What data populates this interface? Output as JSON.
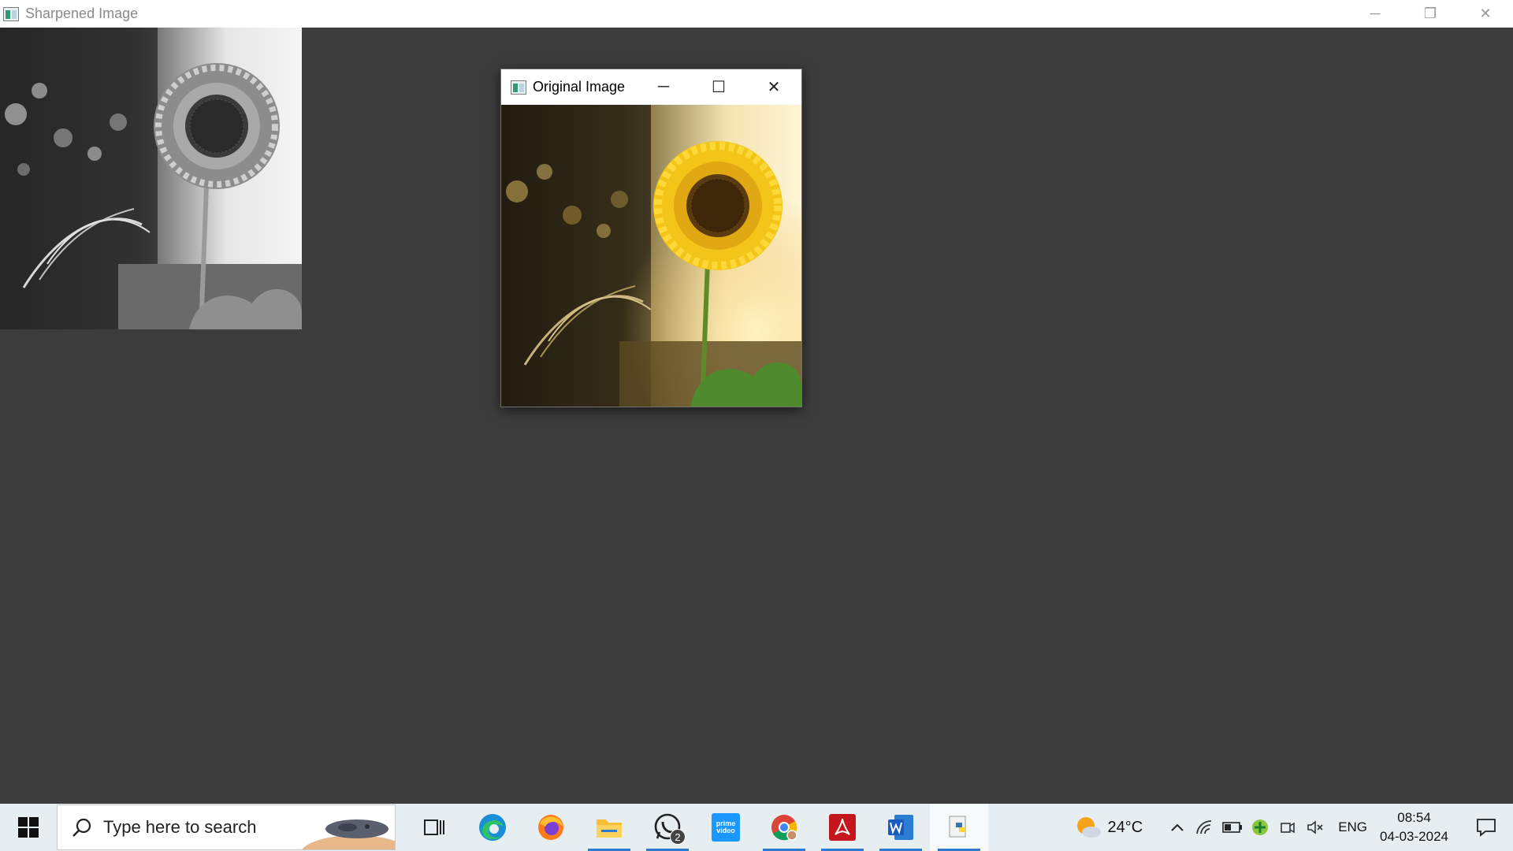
{
  "main_window": {
    "title": "Sharpened Image",
    "minimize_glyph": "─",
    "restore_glyph": "❐",
    "close_glyph": "✕"
  },
  "original_window": {
    "title": "Original Image",
    "minimize_glyph": "─",
    "maximize_glyph": "☐",
    "close_glyph": "✕"
  },
  "taskbar": {
    "search_placeholder": "Type here to search",
    "apps": [
      {
        "name": "task-view",
        "icon": "task-view-icon"
      },
      {
        "name": "edge",
        "icon": "edge-icon"
      },
      {
        "name": "firefox",
        "icon": "firefox-icon"
      },
      {
        "name": "file-explorer",
        "icon": "folder-icon",
        "running": true
      },
      {
        "name": "whatsapp",
        "icon": "whatsapp-icon",
        "badge": "2",
        "running": true
      },
      {
        "name": "prime-video",
        "icon": "prime-video-icon",
        "label": "prime video"
      },
      {
        "name": "chrome",
        "icon": "chrome-icon",
        "running": true
      },
      {
        "name": "acrobat",
        "icon": "acrobat-icon",
        "running": true
      },
      {
        "name": "word",
        "icon": "word-icon",
        "running": true
      },
      {
        "name": "python",
        "icon": "python-icon",
        "running": true,
        "active": true
      }
    ],
    "whatsapp_badge": "2",
    "prime_label": "prime video",
    "weather_temp": "24°C",
    "language": "ENG",
    "time": "08:54",
    "date": "04-03-2024"
  },
  "colors": {
    "desktop_bg": "#3c3c3c",
    "taskbar_bg": "#e6eef2",
    "active_indicator": "#2e7bd1"
  }
}
